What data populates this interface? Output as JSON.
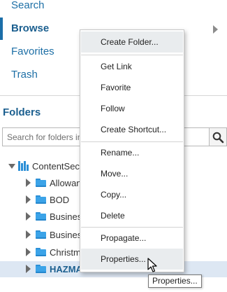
{
  "nav": {
    "items": [
      {
        "label": "Search"
      },
      {
        "label": "Browse"
      },
      {
        "label": "Favorites"
      },
      {
        "label": "Trash"
      }
    ]
  },
  "folders": {
    "title": "Folders",
    "search_placeholder": "Search for folders in Browse",
    "tree": {
      "root": "ContentSecurityLibrary",
      "children": [
        {
          "label": "Allowances"
        },
        {
          "label": "BOD"
        },
        {
          "label": "Business"
        },
        {
          "label": "Business Docs"
        },
        {
          "label": "Christmas"
        },
        {
          "label": "HAZMAT"
        }
      ]
    }
  },
  "context_menu": {
    "items": [
      "Create Folder...",
      "Get Link",
      "Favorite",
      "Follow",
      "Create Shortcut...",
      "Rename...",
      "Move...",
      "Copy...",
      "Delete",
      "Propagate...",
      "Properties..."
    ]
  },
  "tooltip": "Properties...",
  "colors": {
    "link": "#1d6fa6",
    "active_nav": "#1b5f8f",
    "folder": "#3ba3e8",
    "selected_row": "#dde7f3",
    "menu_hover": "#e9ecee"
  }
}
